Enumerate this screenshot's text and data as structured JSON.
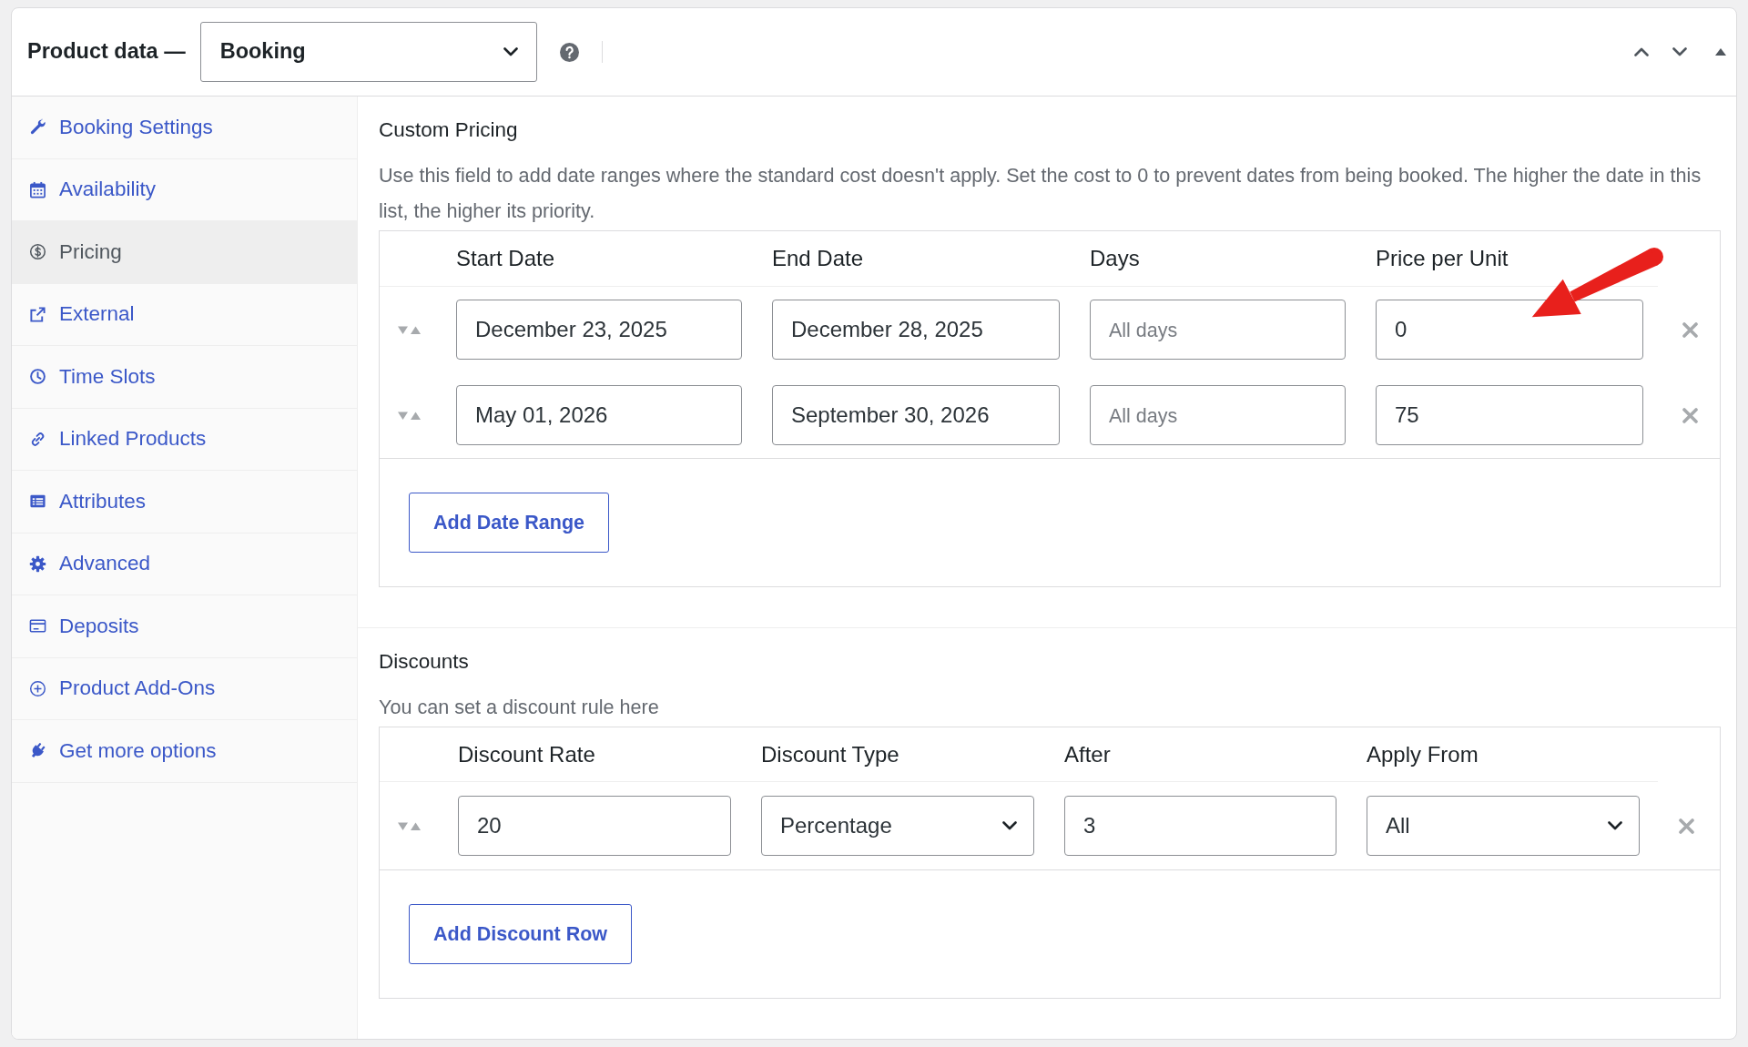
{
  "panel": {
    "title": "Product data —",
    "product_type": {
      "value": "Booking"
    }
  },
  "sidebar": {
    "items": [
      {
        "label": "Booking Settings",
        "selected": false
      },
      {
        "label": "Availability",
        "selected": false
      },
      {
        "label": "Pricing",
        "selected": true
      },
      {
        "label": "External",
        "selected": false
      },
      {
        "label": "Time Slots",
        "selected": false
      },
      {
        "label": "Linked Products",
        "selected": false
      },
      {
        "label": "Attributes",
        "selected": false
      },
      {
        "label": "Advanced",
        "selected": false
      },
      {
        "label": "Deposits",
        "selected": false
      },
      {
        "label": "Product Add-Ons",
        "selected": false
      },
      {
        "label": "Get more options",
        "selected": false
      }
    ]
  },
  "sections": [
    {
      "title": "Custom Pricing",
      "description": "Use this field to add date ranges where the standard cost doesn't apply. Set the cost to 0 to prevent dates from being booked. The higher the date in this list, the higher its priority.",
      "table": {
        "columns": [
          "Start Date",
          "End Date",
          "Days",
          "Price per Unit"
        ],
        "rows": [
          {
            "cells": [
              {
                "kind": "text",
                "value": "December 23, 2025"
              },
              {
                "kind": "text",
                "value": "December 28, 2025"
              },
              {
                "kind": "text",
                "placeholder": "All days"
              },
              {
                "kind": "text",
                "value": "0"
              }
            ]
          },
          {
            "cells": [
              {
                "kind": "text",
                "value": "May 01, 2026"
              },
              {
                "kind": "text",
                "value": "September 30, 2026"
              },
              {
                "kind": "text",
                "placeholder": "All days"
              },
              {
                "kind": "text",
                "value": "75"
              }
            ]
          }
        ]
      },
      "button": "Add Date Range"
    },
    {
      "title": "Discounts",
      "description": "You can set a discount rule here",
      "table": {
        "columns": [
          "Discount Rate",
          "Discount Type",
          "After",
          "Apply From"
        ],
        "rows": [
          {
            "cells": [
              {
                "kind": "text",
                "value": "20"
              },
              {
                "kind": "select",
                "value": "Percentage"
              },
              {
                "kind": "text",
                "value": "3"
              },
              {
                "kind": "select",
                "value": "All"
              }
            ]
          }
        ]
      },
      "button": "Add Discount Row"
    }
  ],
  "annotations": [
    {
      "kind": "arrow"
    }
  ]
}
